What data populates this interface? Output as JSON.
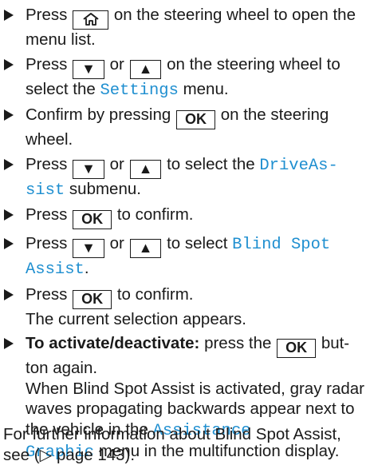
{
  "steps": [
    {
      "pre": "Press",
      "post": "on the steering wheel to open the menu list.",
      "key_icon": "home-icon"
    },
    {
      "pre": "Press",
      "key1": "▼",
      "mid": "or",
      "key2": "▲",
      "post1": "on the steering wheel to select the",
      "menu": "Settings",
      "post2": "menu."
    },
    {
      "pre": "Confirm by pressing",
      "key": "OK",
      "post": "on the steering wheel."
    },
    {
      "pre": "Press",
      "key1": "▼",
      "mid": "or",
      "key2": "▲",
      "post1": "to select the",
      "menu_a": "DriveAs-",
      "menu_b": "sist",
      "post2": "submenu."
    },
    {
      "pre": "Press",
      "key": "OK",
      "post": "to confirm."
    },
    {
      "pre": "Press",
      "key1": "▼",
      "mid": "or",
      "key2": "▲",
      "post1": "to select",
      "menu_a": "Blind Spot",
      "menu_b": "Assist",
      "post2": "."
    },
    {
      "pre": "Press",
      "key": "OK",
      "post": "to confirm.",
      "sub": "The current selection appears."
    },
    {
      "bold": "To activate/deactivate:",
      "pre": "press the",
      "key": "OK",
      "post_a": "but-",
      "post_b": "ton again.",
      "sub": "When Blind Spot Assist is activated, gray radar waves propagating backwards appear next to the vehicle in the",
      "menu_a": "Assistance",
      "menu_b": "Graphic",
      "sub_post": "menu in the multifunction display."
    }
  ],
  "note": "For further information about Blind Spot Assist, see (▷ page 143).",
  "colors": {
    "menu_text": "#1f8fd0",
    "text": "#1a1a1a"
  }
}
